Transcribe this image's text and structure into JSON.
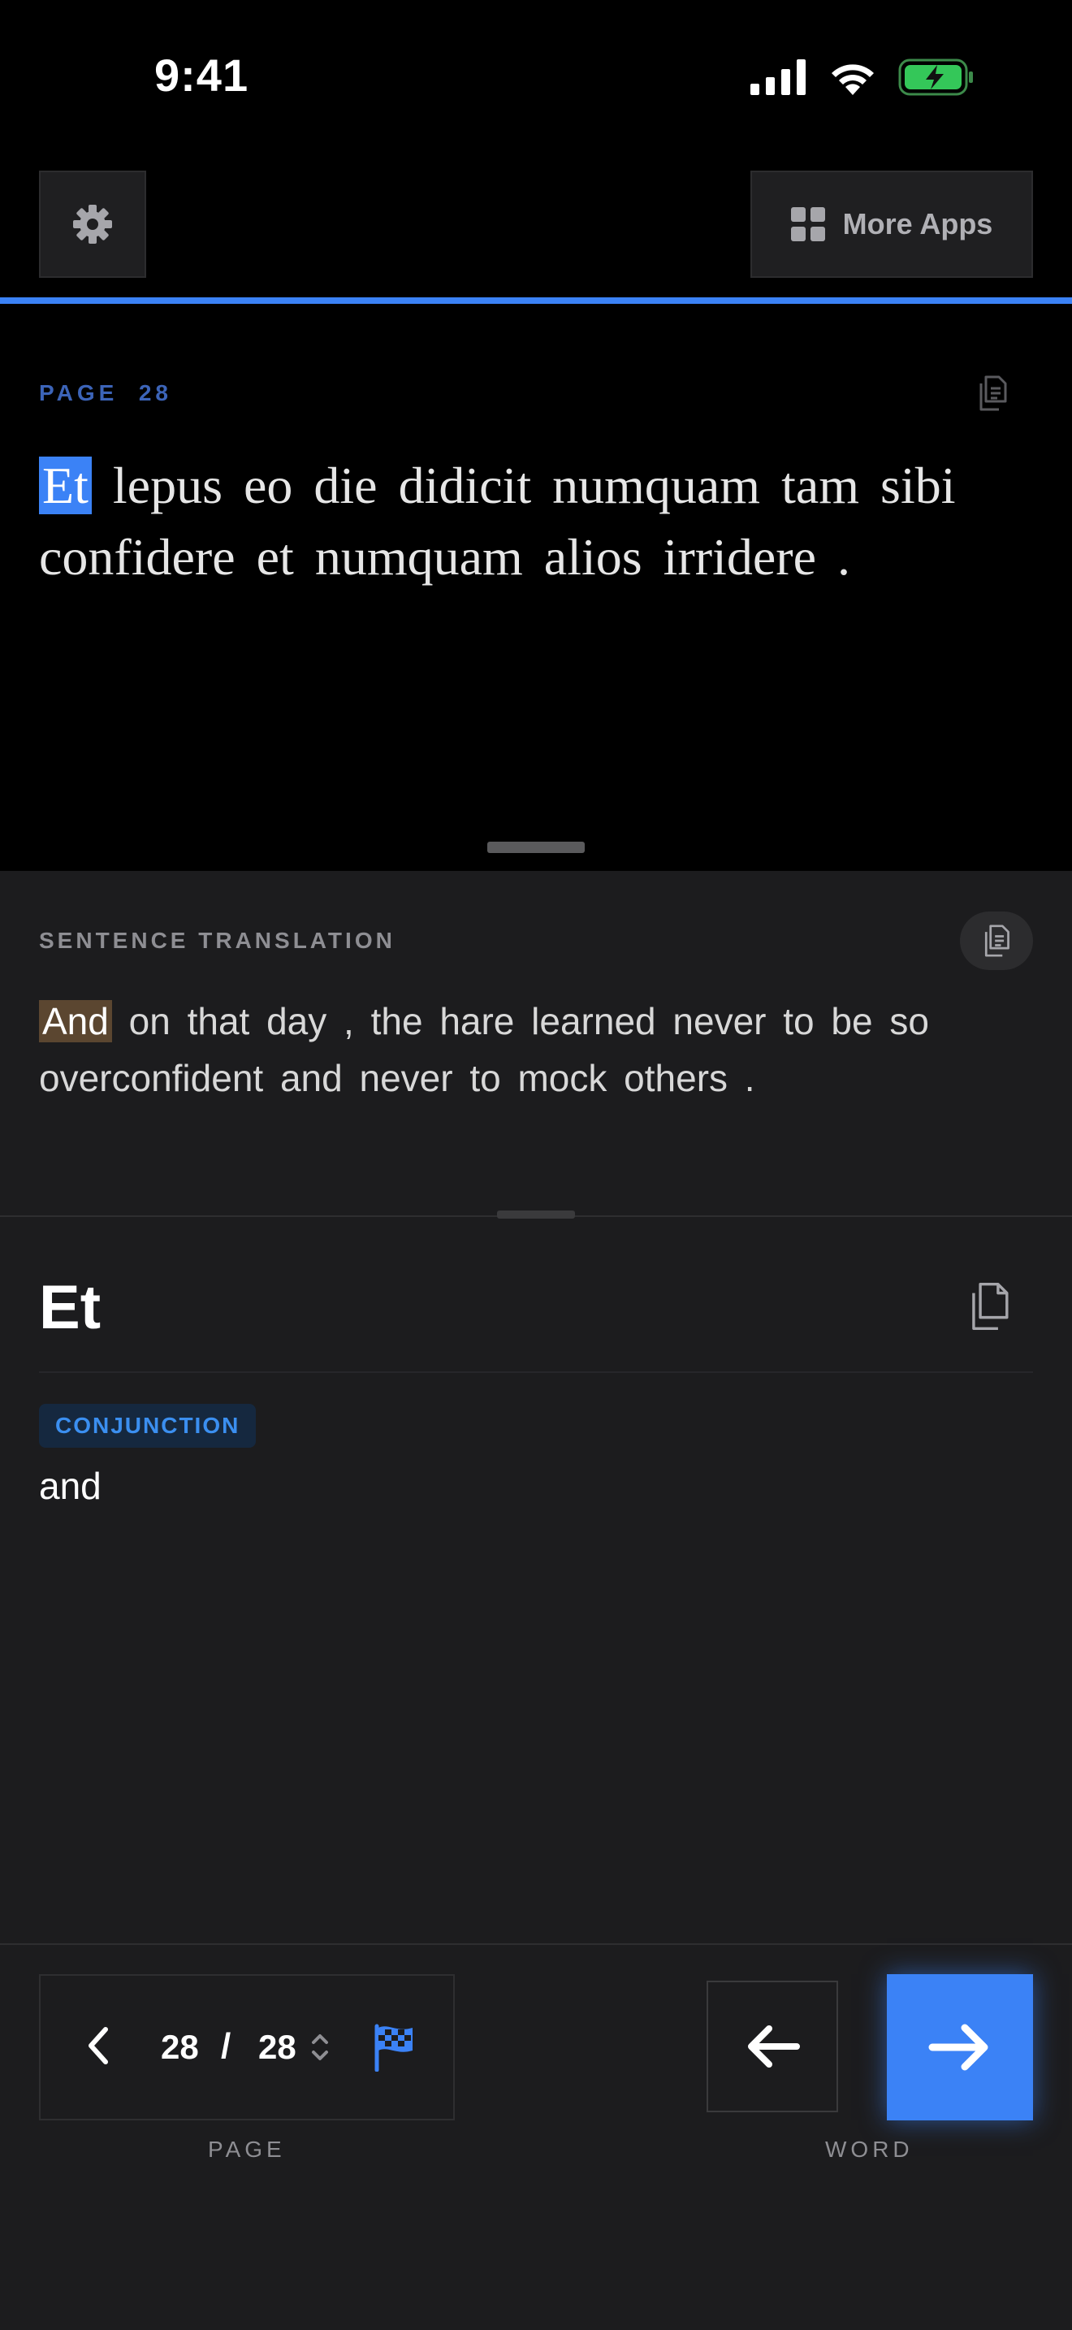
{
  "status_bar": {
    "time": "9:41"
  },
  "toolbar": {
    "more_apps_label": "More Apps"
  },
  "reader": {
    "page_label": "PAGE  28",
    "highlighted_word": "Et",
    "sentence_rest": " lepus eo die didicit numquam tam sibi confidere et numquam alios irridere ."
  },
  "translation": {
    "label": "SENTENCE TRANSLATION",
    "highlighted_word": "And",
    "text_rest": " on that day , the hare learned never to be so overconfident and never to mock others ."
  },
  "word": {
    "title": "Et",
    "part_of_speech": "CONJUNCTION",
    "meaning": "and"
  },
  "pager": {
    "current": "28",
    "separator": "/",
    "total": "28",
    "label": "PAGE"
  },
  "word_nav": {
    "label": "WORD"
  },
  "colors": {
    "accent": "#3b82f6",
    "background": "#1c1c1e",
    "highlight_translation": "#5b4630"
  },
  "icons": [
    "gear-icon",
    "grid-icon",
    "copy-icon",
    "chevron-left-icon",
    "up-down-icon",
    "checkered-flag-icon",
    "arrow-left-icon",
    "arrow-right-icon",
    "signal-icon",
    "wifi-icon",
    "battery-icon"
  ]
}
